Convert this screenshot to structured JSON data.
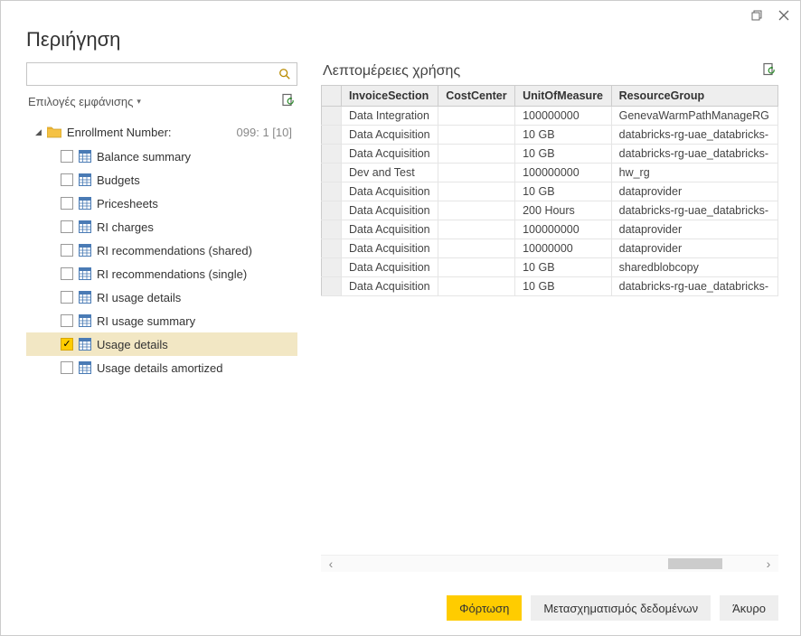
{
  "titlebar": {
    "restore_tooltip": "Restore",
    "close_tooltip": "Close"
  },
  "dialog": {
    "title": "Περιήγηση"
  },
  "left": {
    "search_placeholder": "",
    "display_options": "Επιλογές εμφάνισης"
  },
  "tree": {
    "root": {
      "label": "Enrollment Number:",
      "suffix": "099: 1 [10]"
    },
    "items": [
      {
        "label": "Balance summary",
        "checked": false
      },
      {
        "label": "Budgets",
        "checked": false
      },
      {
        "label": "Pricesheets",
        "checked": false
      },
      {
        "label": "RI charges",
        "checked": false
      },
      {
        "label": "RI recommendations (shared)",
        "checked": false
      },
      {
        "label": "RI recommendations (single)",
        "checked": false
      },
      {
        "label": "RI usage details",
        "checked": false
      },
      {
        "label": "RI usage summary",
        "checked": false
      },
      {
        "label": "Usage details",
        "checked": true
      },
      {
        "label": "Usage details amortized",
        "checked": false
      }
    ]
  },
  "preview": {
    "title": "Λεπτομέρειες χρήσης",
    "columns": [
      "InvoiceSection",
      "CostCenter",
      "UnitOfMeasure",
      "ResourceGroup"
    ],
    "rows": [
      {
        "InvoiceSection": "Data Integration",
        "CostCenter": "",
        "UnitOfMeasure": "100000000",
        "ResourceGroup": "GenevaWarmPathManageRG"
      },
      {
        "InvoiceSection": "Data Acquisition",
        "CostCenter": "",
        "UnitOfMeasure": "10 GB",
        "ResourceGroup": "databricks-rg-uae_databricks-"
      },
      {
        "InvoiceSection": "Data Acquisition",
        "CostCenter": "",
        "UnitOfMeasure": "10 GB",
        "ResourceGroup": "databricks-rg-uae_databricks-"
      },
      {
        "InvoiceSection": "Dev and Test",
        "CostCenter": "",
        "UnitOfMeasure": "100000000",
        "ResourceGroup": "hw_rg"
      },
      {
        "InvoiceSection": "Data Acquisition",
        "CostCenter": "",
        "UnitOfMeasure": "10 GB",
        "ResourceGroup": "dataprovider"
      },
      {
        "InvoiceSection": "Data Acquisition",
        "CostCenter": "",
        "UnitOfMeasure": "200 Hours",
        "ResourceGroup": "databricks-rg-uae_databricks-"
      },
      {
        "InvoiceSection": "Data Acquisition",
        "CostCenter": "",
        "UnitOfMeasure": "100000000",
        "ResourceGroup": "dataprovider"
      },
      {
        "InvoiceSection": "Data Acquisition",
        "CostCenter": "",
        "UnitOfMeasure": "10000000",
        "ResourceGroup": "dataprovider"
      },
      {
        "InvoiceSection": "Data Acquisition",
        "CostCenter": "",
        "UnitOfMeasure": "10 GB",
        "ResourceGroup": "sharedblobcopy"
      },
      {
        "InvoiceSection": "Data Acquisition",
        "CostCenter": "",
        "UnitOfMeasure": "10 GB",
        "ResourceGroup": "databricks-rg-uae_databricks-"
      }
    ]
  },
  "footer": {
    "load": "Φόρτωση",
    "transform": "Μετασχηματισμός δεδομένων",
    "cancel": "Άκυρο"
  }
}
